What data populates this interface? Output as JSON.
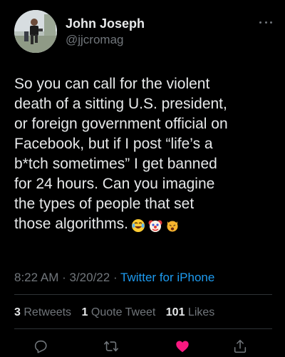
{
  "author": {
    "display_name": "John Joseph",
    "handle": "@jjcromag",
    "avatar_icon": "runner-photo-avatar",
    "more_icon": "more-horizontal-icon"
  },
  "tweet": {
    "text_lines": [
      "So you can call for the violent",
      "death of a sitting U.S. president,",
      "or foreign government official on",
      "Facebook, but if I post “life’s a",
      "b*tch sometimes” I get banned",
      "for 24 hours. Can you imagine",
      "the types of people that set",
      "those algorithms."
    ],
    "emojis": [
      "face-with-tears-of-joy-emoji",
      "clown-face-emoji",
      "weary-cat-face-emoji"
    ]
  },
  "meta": {
    "time": "8:22 AM",
    "separator": " · ",
    "date": "3/20/22",
    "source": "Twitter for iPhone"
  },
  "stats": {
    "retweets_count": "3",
    "retweets_label": "Retweets",
    "quotes_count": "1",
    "quotes_label": "Quote Tweet",
    "likes_count": "101",
    "likes_label": "Likes"
  },
  "actions": [
    {
      "name": "reply",
      "icon": "reply-icon"
    },
    {
      "name": "retweet",
      "icon": "retweet-icon"
    },
    {
      "name": "like",
      "icon": "heart-icon",
      "active": true
    },
    {
      "name": "share",
      "icon": "share-icon"
    }
  ],
  "colors": {
    "background": "#000000",
    "text": "#e7e9ea",
    "secondary": "#71767b",
    "link": "#1d9bf0",
    "like": "#f91880",
    "divider": "#2f3336"
  }
}
